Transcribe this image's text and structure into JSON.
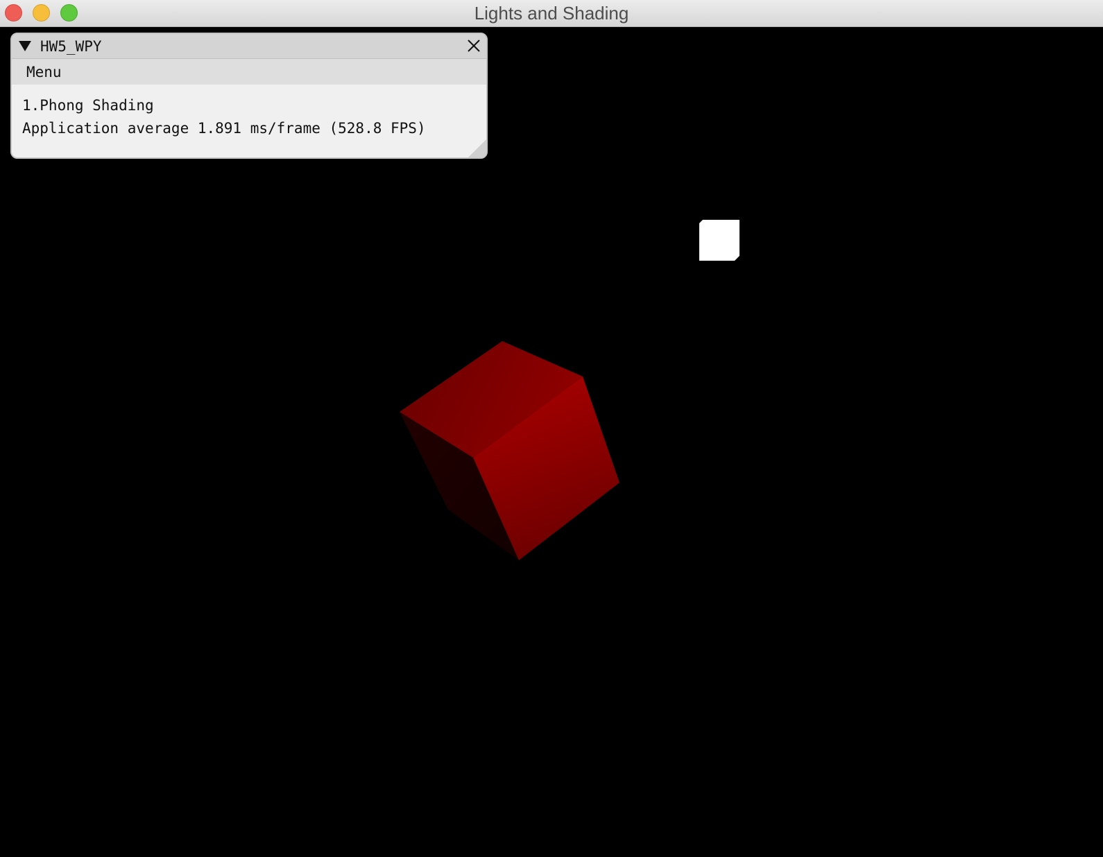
{
  "window": {
    "title": "Lights and Shading"
  },
  "panel": {
    "title": "HW5_WPY",
    "menu_label": "Menu",
    "line1": "1.Phong Shading",
    "line2": "Application average 1.891 ms/frame (528.8 FPS)"
  },
  "colors": {
    "background": "#000000",
    "cube": "#a00000",
    "light": "#ffffff",
    "panel_bg": "#f0f0f0"
  }
}
